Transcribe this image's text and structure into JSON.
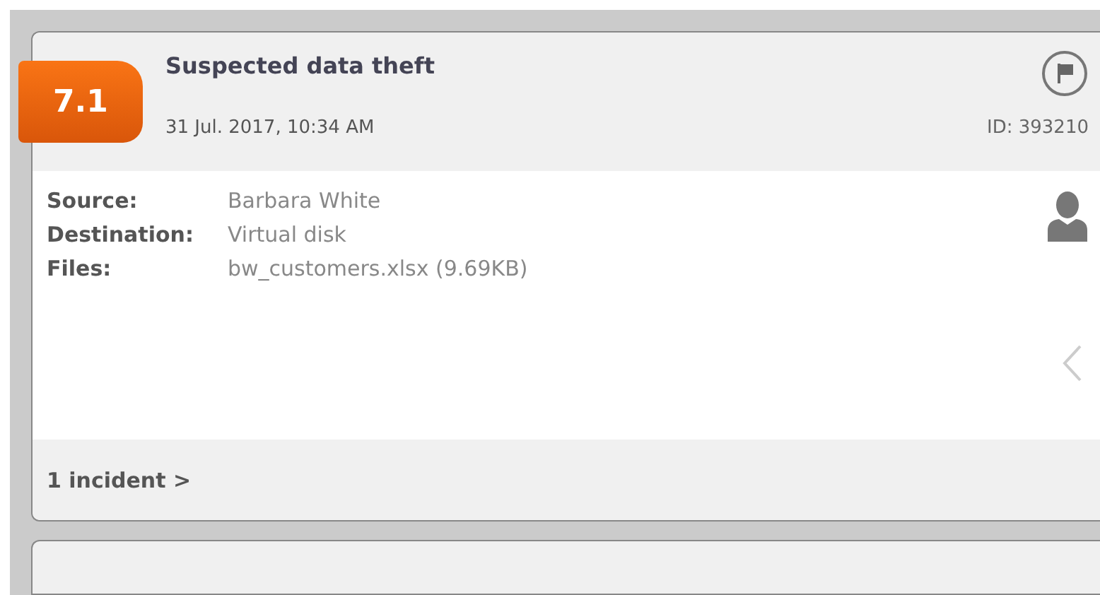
{
  "incident": {
    "score": "7.1",
    "title": "Suspected data theft",
    "datetime": "31 Jul. 2017, 10:34 AM",
    "id": "ID: 393210",
    "details": [
      {
        "label": "Source:",
        "value": "Barbara White"
      },
      {
        "label": "Destination:",
        "value": "Virtual disk"
      },
      {
        "label": "Files:",
        "value": "bw_customers.xlsx (9.69KB)"
      }
    ],
    "footer_link": "1 incident >"
  }
}
